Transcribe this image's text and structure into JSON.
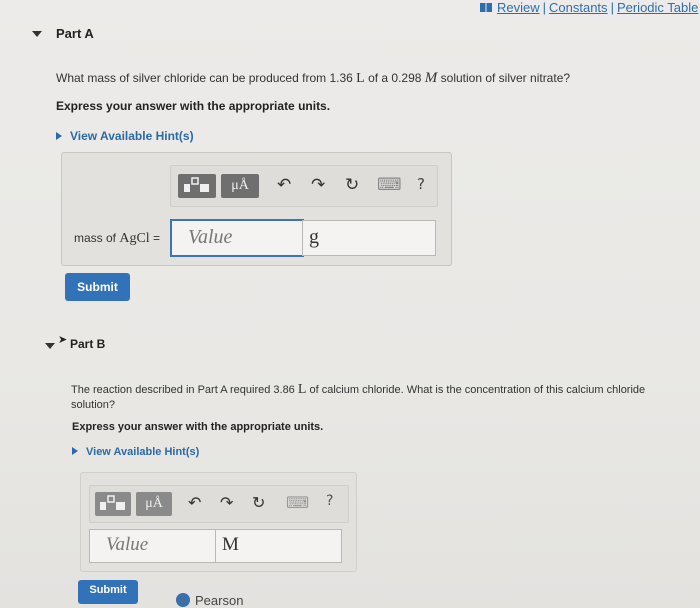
{
  "topbar": {
    "review": "Review",
    "constants": "Constants",
    "periodic_table": "Periodic Table",
    "separator": "|"
  },
  "partA": {
    "title": "Part A",
    "question_pre": "What mass of silver chloride can be produced from 1.36",
    "question_unit": "L",
    "question_mid": "of a 0.298",
    "question_molar": "M",
    "question_post": "solution of silver nitrate?",
    "express": "Express your answer with the appropriate units.",
    "hint": "View Available Hint(s)",
    "toolbar": {
      "templates": "",
      "mu_a": "μÅ",
      "undo": "↶",
      "redo": "↷",
      "reset": "↻",
      "keyboard": "⌨",
      "help": "?"
    },
    "label_prefix": "mass of",
    "label_formula": "AgCl",
    "label_eq": "=",
    "value_placeholder": "Value",
    "unit_value": "g",
    "submit": "Submit"
  },
  "partB": {
    "title": "Part B",
    "question_pre": "The reaction described in Part A required 3.86",
    "question_unit": "L",
    "question_post": "of calcium chloride. What is the concentration of this calcium chloride",
    "question_line2": "solution?",
    "express": "Express your answer with the appropriate units.",
    "hint": "View Available Hint(s)",
    "toolbar": {
      "mu_a": "μÅ",
      "undo": "↶",
      "redo": "↷",
      "reset": "↻",
      "keyboard": "⌨",
      "help": "?"
    },
    "value_placeholder": "Value",
    "unit_value": "M",
    "submit": "Submit"
  },
  "footer": {
    "brand": "Pearson"
  },
  "colors": {
    "link": "#2c6fb0",
    "submit": "#3272b8",
    "focus": "#3b74b8"
  }
}
